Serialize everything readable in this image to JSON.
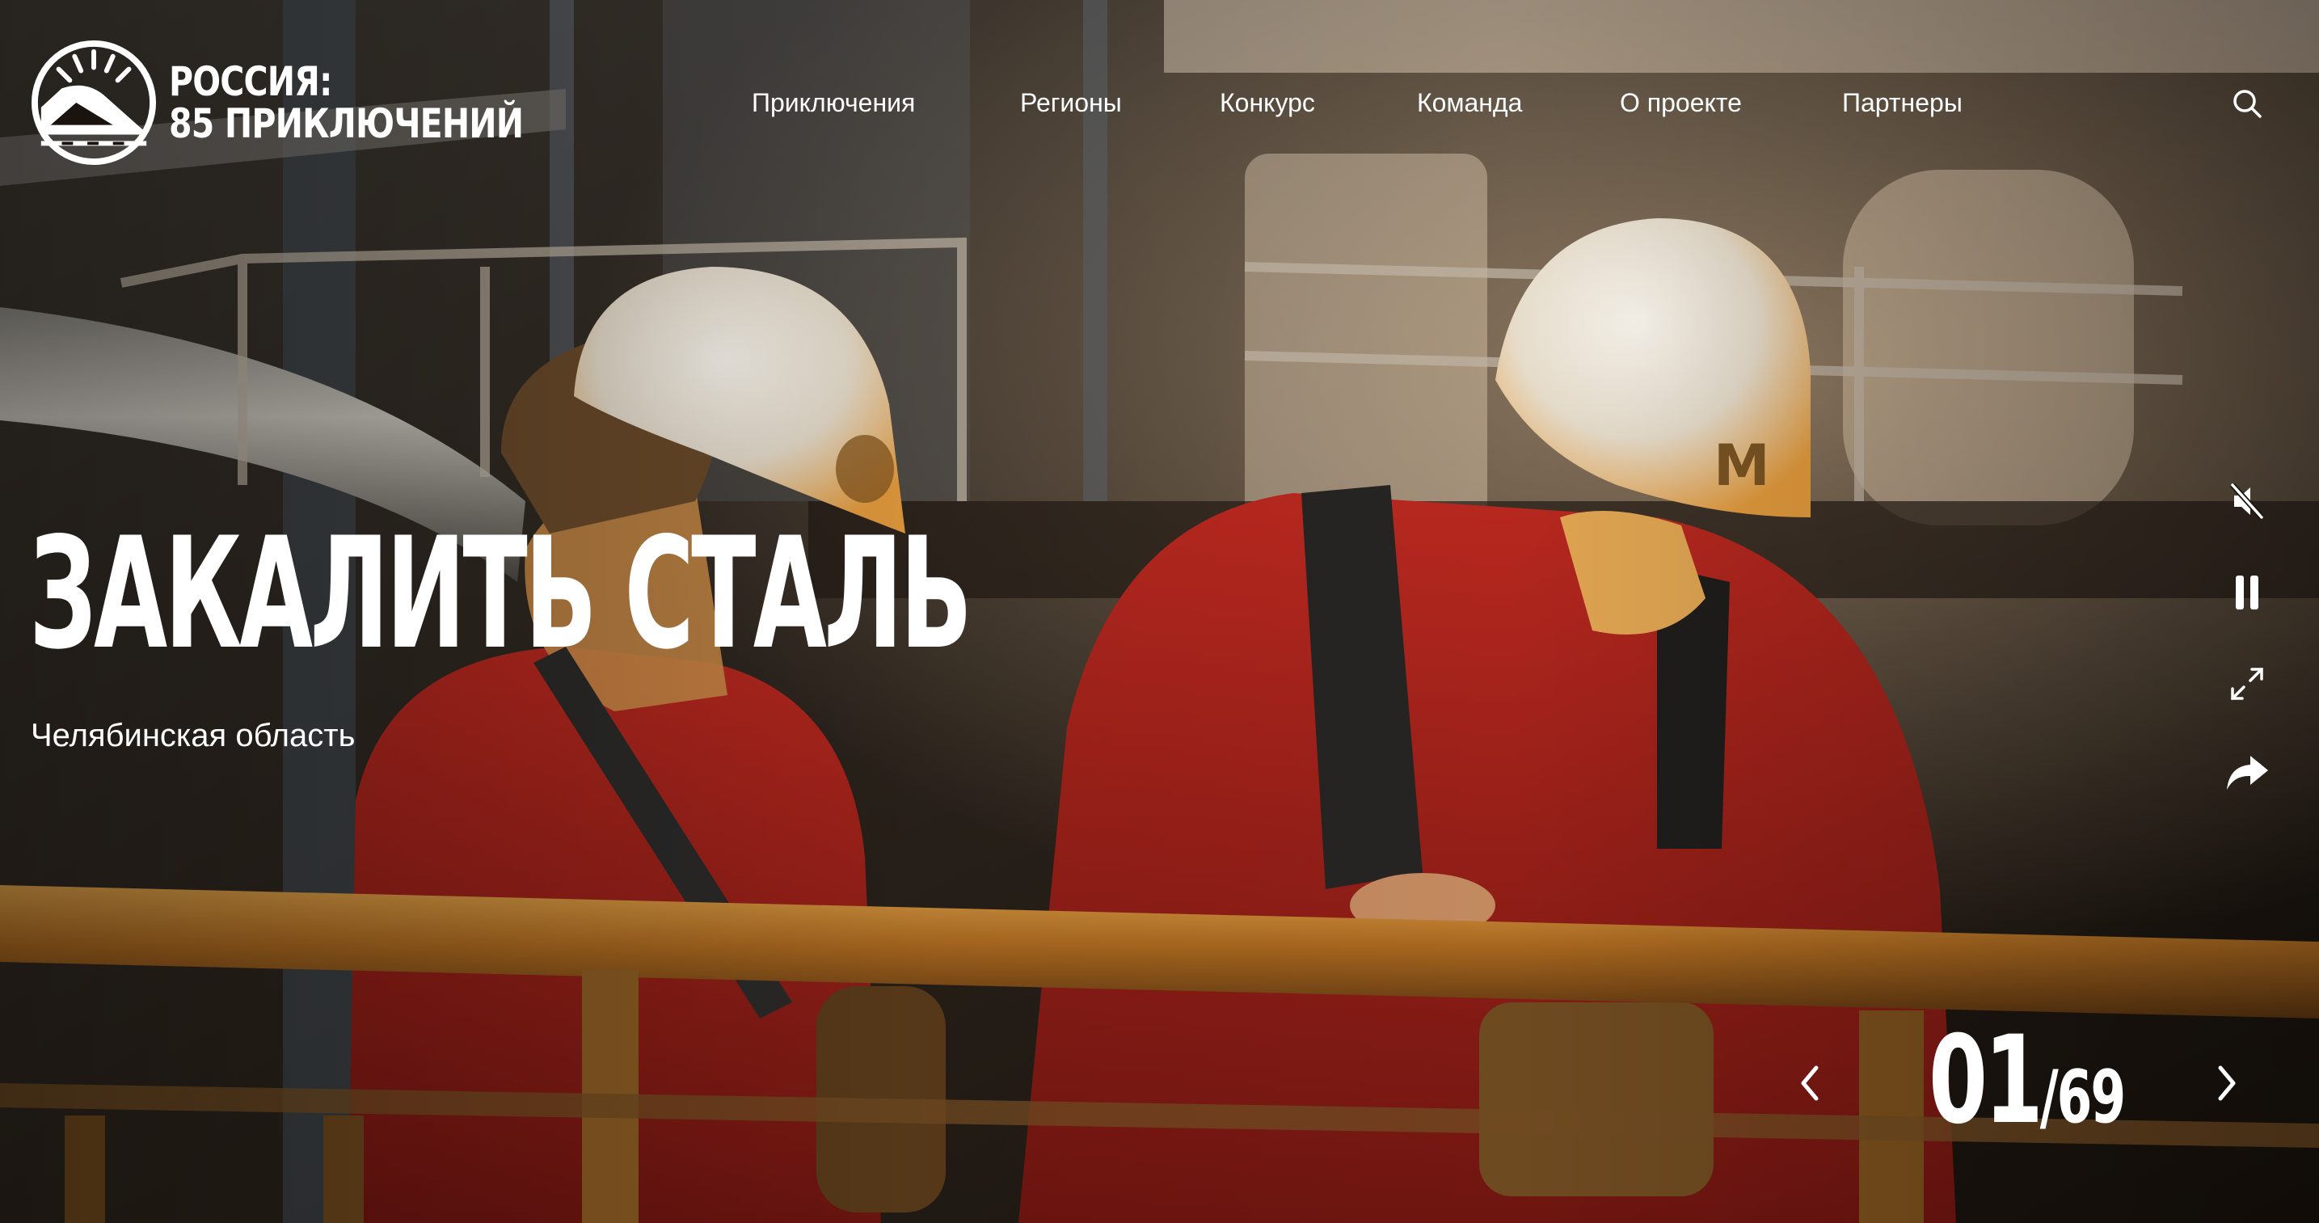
{
  "logo": {
    "line1": "РОССИЯ:",
    "line2": "85 ПРИКЛЮЧЕНИЙ",
    "mark_icon": "sunrise-road-emblem-icon"
  },
  "nav": {
    "items": [
      {
        "label": "Приключения"
      },
      {
        "label": "Регионы"
      },
      {
        "label": "Конкурс"
      },
      {
        "label": "Команда"
      },
      {
        "label": "О проекте"
      },
      {
        "label": "Партнеры"
      }
    ],
    "search_icon": "search-icon"
  },
  "hero": {
    "title": "ЗАКАЛИТЬ СТАЛЬ",
    "subtitle": "Челябинская область",
    "background": "video-still-steelworkers-in-red-uniforms-and-white-helmets"
  },
  "controls": {
    "mute_icon": "speaker-muted-icon",
    "pause_icon": "pause-icon",
    "fullscreen_icon": "expand-icon",
    "share_icon": "share-arrow-icon"
  },
  "slider": {
    "current": "01",
    "separator": "/",
    "total": "69",
    "prev_icon": "chevron-left-icon",
    "next_icon": "chevron-right-icon"
  },
  "colors": {
    "text": "#ffffff",
    "uniform_red": "#a8231c",
    "helmet": "#e9e2d6",
    "steel_gold": "#b8792c"
  }
}
